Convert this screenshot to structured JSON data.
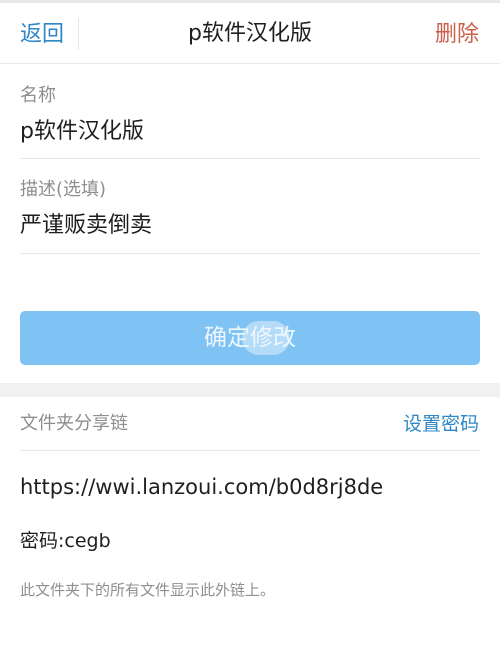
{
  "header": {
    "back_label": "返回",
    "title": "p软件汉化版",
    "delete_label": "删除"
  },
  "form": {
    "name_label": "名称",
    "name_value": "p软件汉化版",
    "description_label": "描述(选填)",
    "description_value": "严谨贩卖倒卖"
  },
  "actions": {
    "confirm_label": "确定修改"
  },
  "share": {
    "label": "文件夹分享链",
    "set_password_label": "设置密码",
    "url": "https://wwi.lanzoui.com/b0d8rj8de",
    "password_text": "密码:cegb",
    "footnote": "此文件夹下的所有文件显示此外链上。"
  },
  "colors": {
    "accent_blue": "#2f87c7",
    "delete_red": "#c95e4a",
    "button_blue": "#7fc3f4",
    "muted_text": "#8e8e8e"
  }
}
